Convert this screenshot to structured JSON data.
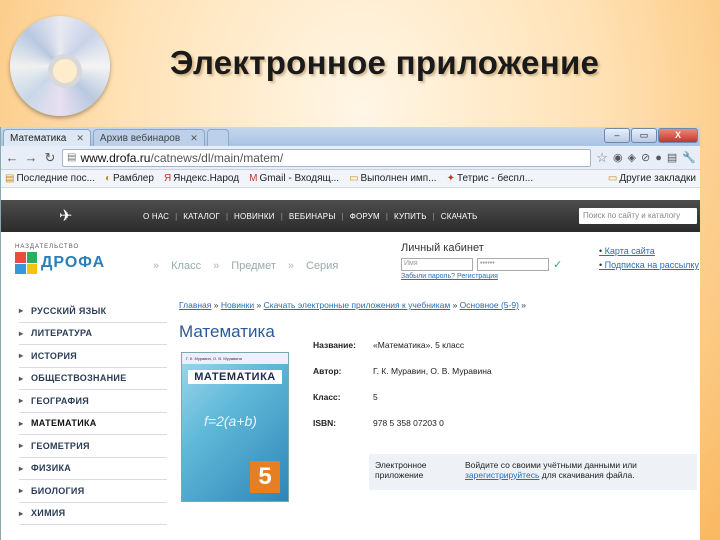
{
  "slide": {
    "title": "Электронное приложение"
  },
  "browser": {
    "tabs": [
      {
        "label": "Математика",
        "active": true
      },
      {
        "label": "Архив вебинаров",
        "active": false
      }
    ],
    "url_host": "www.drofa.ru",
    "url_path": "/catnews/dl/main/matem/",
    "bookmarks": [
      "Последние пос...",
      "Рамблер",
      "Яндекс.Народ",
      "Gmail - Входящ...",
      "Выполнен имп...",
      "Тетрис - беспл...",
      "Другие закладки"
    ]
  },
  "site": {
    "nav": [
      "О НАС",
      "КАТАЛОГ",
      "НОВИНКИ",
      "ВЕБИНАРЫ",
      "ФОРУМ",
      "КУПИТЬ",
      "СКАЧАТЬ"
    ],
    "search_placeholder": "Поиск по сайту и каталогу",
    "logo_small": "НАЗДАТЕЛЬСТВО",
    "logo_word": "ДРОФА",
    "crumbs": [
      "Класс",
      "Предмет",
      "Серия"
    ],
    "cabinet": {
      "title": "Личный кабинет",
      "login_placeholder": "Имя",
      "password_placeholder": "••••••",
      "links": "Забыли пароль? Регистрация"
    },
    "side_links": [
      "Карта сайта",
      "Подписка на рассылку"
    ],
    "subjects": [
      "РУССКИЙ ЯЗЫК",
      "ЛИТЕРАТУРА",
      "ИСТОРИЯ",
      "ОБЩЕСТВОЗНАНИЕ",
      "ГЕОГРАФИЯ",
      "МАТЕМАТИКА",
      "ГЕОМЕТРИЯ",
      "ФИЗИКА",
      "БИОЛОГИЯ",
      "ХИМИЯ"
    ],
    "breadcrumb": [
      "Главная",
      "Новинки",
      "Скачать электронные приложения к учебникам",
      "Основное (5-9)"
    ],
    "page_heading": "Математика",
    "book": {
      "authors": "Г. К. Муравин, О. В. Муравина",
      "title": "МАТЕМАТИКА",
      "formula": "f=2(a+b)",
      "grade": "5"
    },
    "details": [
      {
        "label": "Название:",
        "value": "«Математика». 5 класс"
      },
      {
        "label": "Автор:",
        "value": "Г. К. Муравин, О. В. Муравина"
      },
      {
        "label": "Класс:",
        "value": "5"
      },
      {
        "label": "ISBN:",
        "value": "978 5 358 07203 0"
      }
    ],
    "eapp": {
      "label": "Электронное приложение",
      "text_before": "Войдите со своими учётными данными или",
      "link": "зарегистрируйтесь",
      "text_after": "для скачивания файла."
    }
  }
}
